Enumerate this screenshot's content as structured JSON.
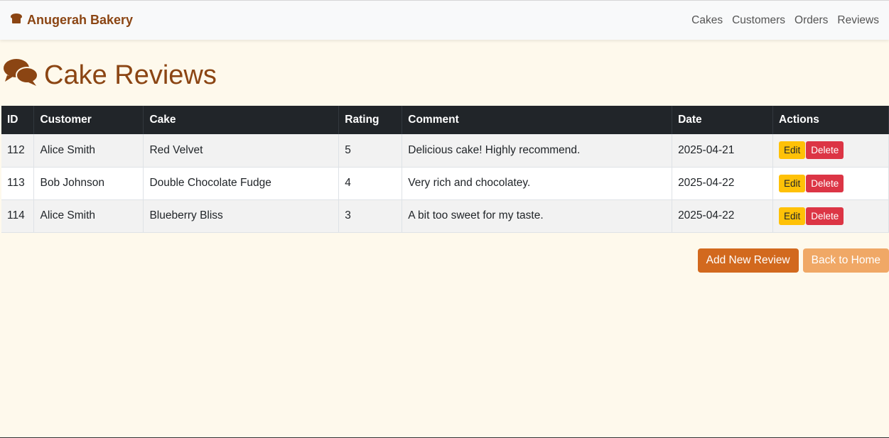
{
  "navbar": {
    "brand": "Anugerah Bakery",
    "brand_icon": "bread-icon",
    "links": [
      "Cakes",
      "Customers",
      "Orders",
      "Reviews"
    ]
  },
  "page": {
    "title": "Cake Reviews",
    "title_icon": "comments-icon"
  },
  "table": {
    "headers": [
      "ID",
      "Customer",
      "Cake",
      "Rating",
      "Comment",
      "Date",
      "Actions"
    ],
    "rows": [
      {
        "id": "112",
        "customer": "Alice Smith",
        "cake": "Red Velvet",
        "rating": "5",
        "comment": "Delicious cake! Highly recommend.",
        "date": "2025-04-21"
      },
      {
        "id": "113",
        "customer": "Bob Johnson",
        "cake": "Double Chocolate Fudge",
        "rating": "4",
        "comment": "Very rich and chocolatey.",
        "date": "2025-04-22"
      },
      {
        "id": "114",
        "customer": "Alice Smith",
        "cake": "Blueberry Bliss",
        "rating": "3",
        "comment": "A bit too sweet for my taste.",
        "date": "2025-04-22"
      }
    ],
    "edit_label": "Edit",
    "delete_label": "Delete"
  },
  "buttons": {
    "add_review": "Add New Review",
    "back_home": "Back to Home"
  },
  "colors": {
    "brand": "#8b4513",
    "background": "#fef9ec",
    "primary_button": "#d2691e",
    "secondary_button": "#f0a866",
    "edit": "#ffc107",
    "delete": "#dc3545",
    "table_header": "#212529"
  }
}
